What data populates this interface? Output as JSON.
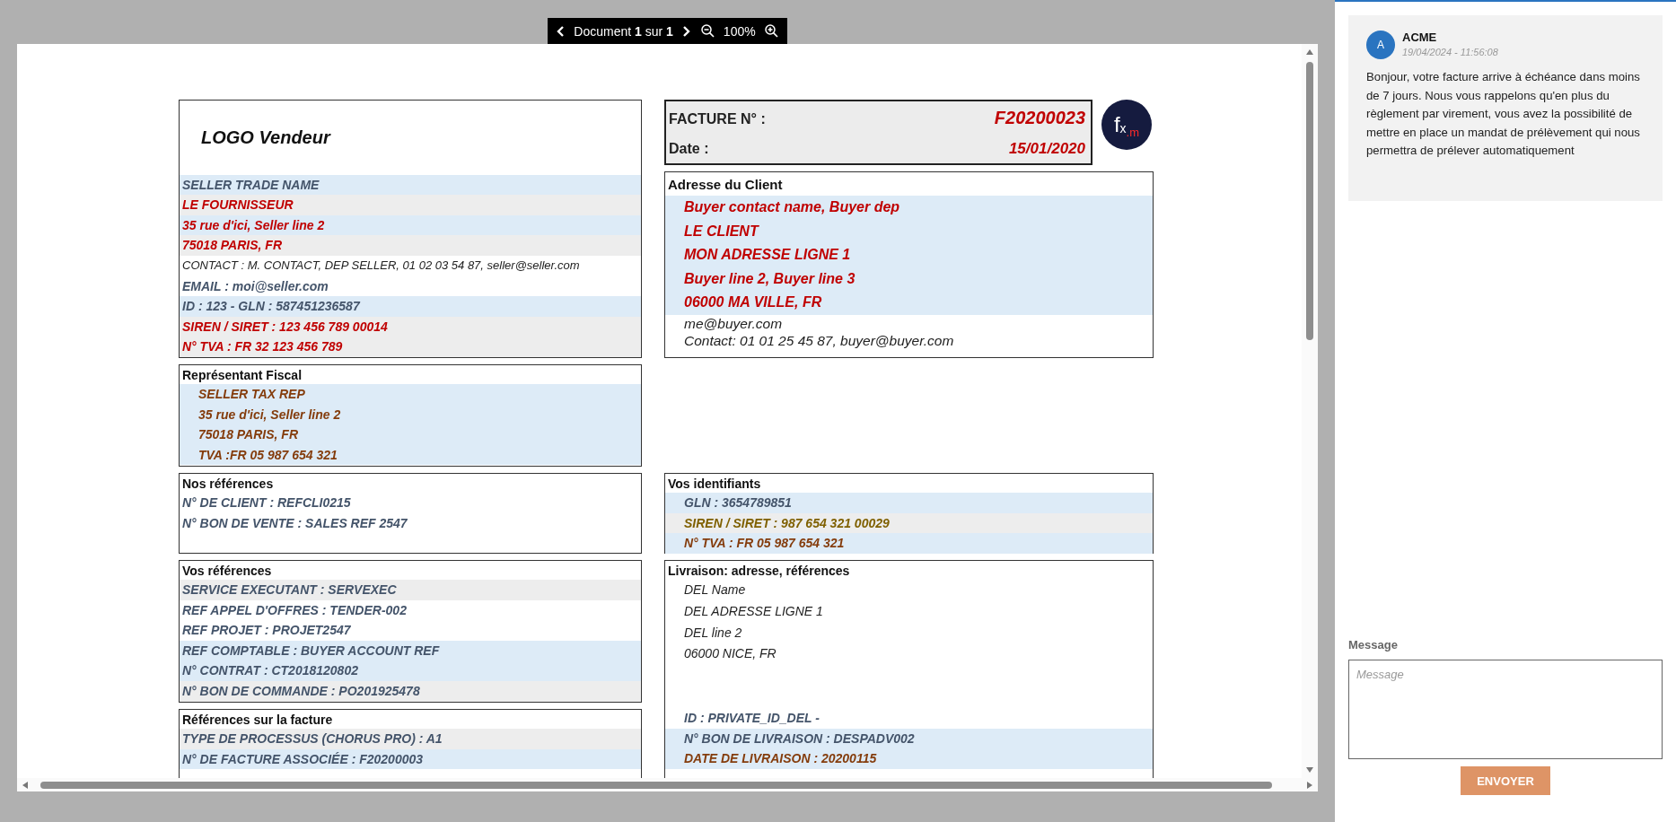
{
  "toolbar": {
    "page_label": "Document **1** sur **1**",
    "zoom": "100%"
  },
  "seller": {
    "logo_text": "LOGO Vendeur",
    "lines": [
      {
        "text": "SELLER TRADE NAME",
        "kind": "bold",
        "color": "#44546a",
        "band": {
          "color": "#ddebf7"
        }
      },
      {
        "text": "LE FOURNISSEUR",
        "kind": "bold",
        "color": "#c00000",
        "band": {
          "color": "#ededed"
        }
      },
      {
        "text": "35 rue d'ici, Seller line 2",
        "kind": "bold",
        "color": "#c00000",
        "band": {
          "color": "#ddebf7"
        }
      },
      {
        "text": "75018 PARIS, FR",
        "kind": "bold",
        "color": "#c00000",
        "band": {
          "color": "#ededed"
        }
      },
      {
        "text": "CONTACT : M. CONTACT, DEP SELLER, 01 02 03 54 87, seller@seller.com",
        "kind": "plain",
        "color": "#222222"
      },
      {
        "text": "EMAIL : moi@seller.com",
        "kind": "bold",
        "color": "#44546a"
      },
      {
        "text": "ID : 123 - GLN : 587451236587",
        "kind": "bold",
        "color": "#44546a",
        "band": {
          "color": "#ddebf7"
        }
      },
      {
        "text": "SIREN / SIRET : 123 456 789 00014",
        "kind": "bold",
        "color": "#c00000",
        "band": {
          "color": "#ededed"
        }
      },
      {
        "text": "N° TVA : FR 32 123 456 789",
        "kind": "bold",
        "color": "#c00000",
        "band": {
          "color": "#ededed"
        }
      }
    ]
  },
  "invoice_header": {
    "number_label": "FACTURE N° :",
    "number": "F20200023",
    "date_label": "Date :",
    "date": "15/01/2020"
  },
  "brand_logo": {
    "main": "f",
    "sub": "x",
    "accent": ".m"
  },
  "client_address": {
    "title": "Adresse du Client",
    "lines": [
      {
        "text": "Buyer contact name, Buyer dep",
        "kind": "bold",
        "color": "#c00000",
        "band": {
          "color": "#ddebf7"
        }
      },
      {
        "text": "LE CLIENT",
        "kind": "bold",
        "color": "#c00000",
        "band": {
          "color": "#ddebf7"
        }
      },
      {
        "text": "MON ADRESSE LIGNE 1",
        "kind": "bold",
        "color": "#c00000",
        "band": {
          "color": "#ddebf7"
        }
      },
      {
        "text": "Buyer line 2, Buyer line 3",
        "kind": "bold",
        "color": "#c00000",
        "band": {
          "color": "#ddebf7"
        }
      },
      {
        "text": "06000 MA VILLE, FR",
        "kind": "bold",
        "color": "#c00000",
        "band": {
          "color": "#ddebf7"
        }
      },
      {
        "text": "me@buyer.com",
        "kind": "plain",
        "color": "#222222"
      },
      {
        "text": "Contact: 01 01 25 45 87, buyer@buyer.com",
        "kind": "plain",
        "color": "#222222"
      }
    ]
  },
  "fiscal_representative": {
    "title": "Représentant Fiscal",
    "lines": [
      {
        "text": "SELLER TAX REP",
        "kind": "bold",
        "color": "#843c0c",
        "band": {
          "color": "#ddebf7"
        }
      },
      {
        "text": "35 rue d'ici, Seller line 2",
        "kind": "bold",
        "color": "#843c0c",
        "band": {
          "color": "#ddebf7"
        }
      },
      {
        "text": "75018 PARIS, FR",
        "kind": "bold",
        "color": "#843c0c",
        "band": {
          "color": "#ddebf7"
        }
      },
      {
        "text": "TVA :FR 05 987 654 321",
        "kind": "bold",
        "color": "#843c0c",
        "band": {
          "color": "#ddebf7"
        }
      }
    ]
  },
  "our_references": {
    "title": "Nos références",
    "lines": [
      {
        "text": "N° DE CLIENT : REFCLI0215",
        "kind": "bold",
        "color": "#44546a"
      },
      {
        "text": "N° BON DE VENTE : SALES REF 2547",
        "kind": "bold",
        "color": "#44546a"
      }
    ]
  },
  "your_identifiers": {
    "title": "Vos identifiants",
    "lines": [
      {
        "text": "GLN : 3654789851",
        "kind": "bold",
        "color": "#44546a",
        "band": {
          "color": "#ddebf7"
        }
      },
      {
        "text": "SIREN / SIRET : 987 654 321 00029",
        "kind": "bold",
        "color": "#7f6000",
        "band": {
          "color": "#ededed"
        }
      },
      {
        "text": "N° TVA : FR 05 987 654 321",
        "kind": "bold",
        "color": "#843c0c",
        "band": {
          "color": "#ddebf7"
        }
      }
    ]
  },
  "your_references": {
    "title": "Vos références",
    "lines": [
      {
        "text": "SERVICE EXECUTANT : SERVEXEC",
        "kind": "bold",
        "color": "#44546a",
        "band": {
          "color": "#ededed"
        }
      },
      {
        "text": "REF APPEL D'OFFRES : TENDER-002",
        "kind": "bold",
        "color": "#44546a"
      },
      {
        "text": "REF PROJET : PROJET2547",
        "kind": "bold",
        "color": "#44546a"
      },
      {
        "text": "REF COMPTABLE : BUYER ACCOUNT REF",
        "kind": "bold",
        "color": "#44546a",
        "band": {
          "color": "#ddebf7"
        }
      },
      {
        "text": "N° CONTRAT : CT2018120802",
        "kind": "bold",
        "color": "#44546a",
        "band": {
          "color": "#ddebf7"
        }
      },
      {
        "text": "N° BON DE COMMANDE : PO201925478",
        "kind": "bold",
        "color": "#44546a",
        "band": {
          "color": "#ededed"
        }
      }
    ]
  },
  "delivery": {
    "title": "Livraison: adresse, références",
    "address_lines": [
      {
        "text": "DEL Name",
        "kind": "plain",
        "color": "#222222"
      },
      {
        "text": "DEL ADRESSE LIGNE 1",
        "kind": "plain",
        "color": "#222222"
      },
      {
        "text": "DEL line 2",
        "kind": "plain",
        "color": "#222222"
      },
      {
        "text": "06000 NICE, FR",
        "kind": "plain",
        "color": "#222222"
      }
    ],
    "reference_lines": [
      {
        "text": "ID : PRIVATE_ID_DEL -",
        "kind": "bold",
        "color": "#44546a"
      },
      {
        "text": "N° BON DE LIVRAISON : DESPADV002",
        "kind": "bold",
        "color": "#44546a",
        "band": {
          "color": "#ddebf7"
        }
      },
      {
        "text": "DATE DE LIVRAISON : 20200115",
        "kind": "bold",
        "color": "#843c0c",
        "band": {
          "color": "#ddebf7"
        }
      }
    ]
  },
  "invoice_references": {
    "title": "Références sur la facture",
    "lines": [
      {
        "text": "TYPE DE PROCESSUS (CHORUS PRO) : A1",
        "kind": "bold",
        "color": "#44546a",
        "band": {
          "color": "#ededed"
        }
      },
      {
        "text": "N° DE FACTURE ASSOCIÉE : F20200003",
        "kind": "bold",
        "color": "#44546a",
        "band": {
          "color": "#ddebf7"
        }
      }
    ]
  },
  "chat": {
    "messages": [
      {
        "avatar": "A",
        "author": "ACME",
        "time": "19/04/2024 - 11:56:08",
        "text": "Bonjour, votre facture arrive à échéance dans moins de 7 jours. Nous vous rappelons qu'en plus du règlement par virement, vous avez la possibilité de mettre en place un mandat de prélèvement qui nous permettra de prélever automatiquement"
      }
    ],
    "form": {
      "label": "Message",
      "placeholder": "Message",
      "button": "ENVOYER"
    }
  }
}
